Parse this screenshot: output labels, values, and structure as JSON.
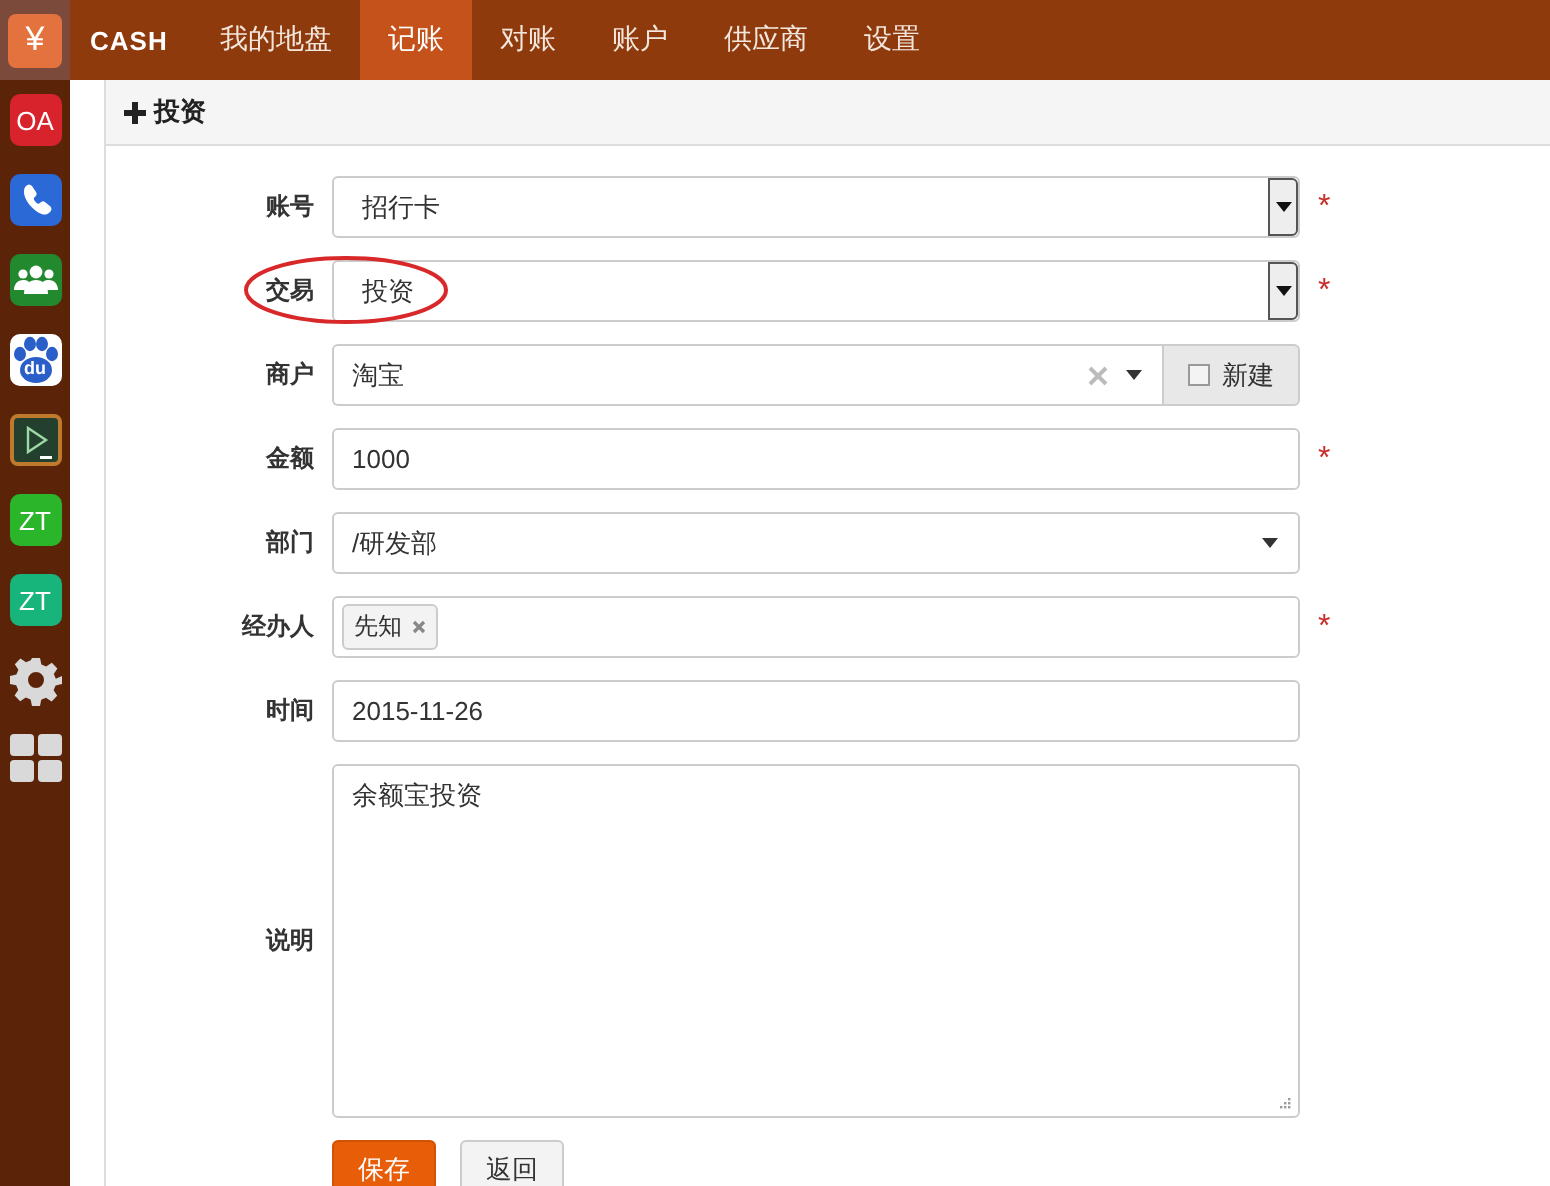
{
  "launcher": {
    "logo": "¥",
    "apps": [
      {
        "kind": "text",
        "label": "OA",
        "color": "#d8222c"
      },
      {
        "kind": "phone",
        "color": "#2b69d6"
      },
      {
        "kind": "group",
        "color": "#23892f"
      },
      {
        "kind": "paw",
        "label": "du",
        "color": "#2a5ec8"
      },
      {
        "kind": "play",
        "color": "#23402f"
      },
      {
        "kind": "text",
        "label": "ZT",
        "color": "#2bb52b"
      },
      {
        "kind": "text",
        "label": "ZT",
        "color": "#17b57c"
      },
      {
        "kind": "gear"
      },
      {
        "kind": "grid"
      }
    ]
  },
  "nav": {
    "brand": "CASH",
    "tabs": [
      {
        "label": "我的地盘",
        "selected": false
      },
      {
        "label": "记账",
        "selected": true
      },
      {
        "label": "对账",
        "selected": false
      },
      {
        "label": "账户",
        "selected": false
      },
      {
        "label": "供应商",
        "selected": false
      },
      {
        "label": "设置",
        "selected": false
      }
    ]
  },
  "panel": {
    "title": "投资"
  },
  "form": {
    "fields": [
      {
        "label": "账号",
        "kind": "select",
        "value": "招行卡",
        "required_mark": "*",
        "circled": false
      },
      {
        "label": "交易",
        "kind": "select",
        "value": "投资",
        "required_mark": "*",
        "circled": true
      },
      {
        "label": "商户",
        "kind": "combo",
        "value": "淘宝",
        "circled": false,
        "addon": {
          "label": "新建",
          "checked": false
        }
      },
      {
        "label": "金额",
        "kind": "text",
        "value": "1000",
        "required_mark": "*",
        "circled": false
      },
      {
        "label": "部门",
        "kind": "chosen",
        "value": "/研发部",
        "circled": false
      },
      {
        "label": "经办人",
        "kind": "tags",
        "tags": [
          "先知"
        ],
        "required_mark": "*",
        "circled": false
      },
      {
        "label": "时间",
        "kind": "text",
        "value": "2015-11-26",
        "circled": false
      },
      {
        "label": "说明",
        "kind": "textarea",
        "value": "余额宝投资",
        "circled": false
      }
    ],
    "buttons": [
      {
        "label": "保存",
        "kind": "primary"
      },
      {
        "label": "返回",
        "kind": "default"
      }
    ]
  }
}
